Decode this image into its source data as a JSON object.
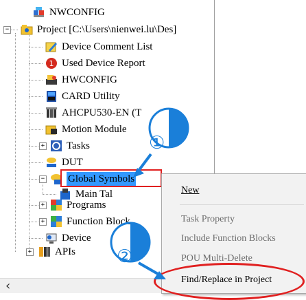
{
  "tree": {
    "items": [
      {
        "label": "NWCONFIG",
        "icon": "nwconfig-icon"
      },
      {
        "label": "Project [C:\\Users\\nienwei.lu\\Des]",
        "icon": "project-icon",
        "toggle": "−"
      },
      {
        "label": "Device Comment List",
        "icon": "comment-list-icon"
      },
      {
        "label": "Used Device Report",
        "icon": "device-report-icon"
      },
      {
        "label": "HWCONFIG",
        "icon": "hwconfig-icon"
      },
      {
        "label": "CARD Utility",
        "icon": "card-utility-icon"
      },
      {
        "label": "AHCPU530-EN  (T",
        "icon": "plc-cpu-icon"
      },
      {
        "label": "Motion Module",
        "icon": "motion-module-icon"
      },
      {
        "label": "Tasks",
        "icon": "tasks-icon",
        "toggle": "+"
      },
      {
        "label": "DUT",
        "icon": "dut-icon"
      },
      {
        "label": "Global Symbols",
        "icon": "global-symbols-icon",
        "toggle": "−"
      },
      {
        "label": "Main Tal",
        "icon": "main-table-icon"
      },
      {
        "label": "Programs",
        "icon": "programs-icon",
        "toggle": "+"
      },
      {
        "label": "Function Block",
        "icon": "function-block-icon",
        "toggle": "+"
      },
      {
        "label": "Device",
        "icon": "device-monitor-icon"
      },
      {
        "label": "APIs",
        "icon": "apis-icon",
        "toggle": "+"
      }
    ]
  },
  "context_menu": {
    "items": [
      {
        "label": "New",
        "enabled": true,
        "underline": "N"
      },
      {
        "label": "Task Property",
        "enabled": false
      },
      {
        "label": "Include Function Blocks",
        "enabled": false
      },
      {
        "label": "POU Multi-Delete",
        "enabled": false
      },
      {
        "label": "Find/Replace in Project",
        "enabled": true
      }
    ]
  },
  "callouts": [
    {
      "number": "①",
      "color": "#1a7fd9"
    },
    {
      "number": "②",
      "color": "#1a7fd9"
    }
  ],
  "colors": {
    "highlight": "#e02020",
    "callout_blue": "#1a7fd9",
    "menu_bg": "#f2f2f2"
  },
  "scrollbar": {
    "left_arrow": "‹"
  }
}
